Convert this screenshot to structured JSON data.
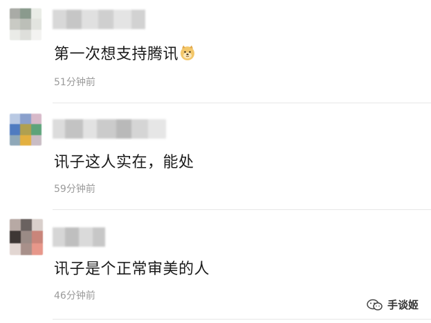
{
  "comments": [
    {
      "text": "第一次想支持腾讯",
      "time": "51分钟前",
      "emoji": "doge-icon"
    },
    {
      "text": "讯子这人实在，能处",
      "time": "59分钟前"
    },
    {
      "text": "讯子是个正常审美的人",
      "time": "46分钟前"
    }
  ],
  "watermark": {
    "label": "手谈姬"
  },
  "colors": {
    "text": "#1a1a1a",
    "time": "#9a9a9a",
    "divider": "#e6e6e6"
  }
}
